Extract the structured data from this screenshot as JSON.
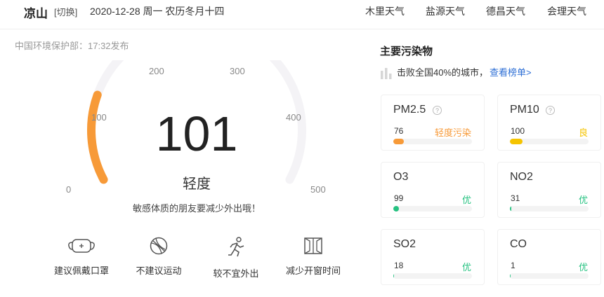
{
  "header": {
    "city": "凉山",
    "switch_label": "[切换]",
    "date_line": "2020-12-28  周一  农历冬月十四",
    "nearby": [
      "木里天气",
      "盐源天气",
      "德昌天气",
      "会理天气"
    ]
  },
  "publish": "中国环境保护部：17:32发布",
  "aqi": {
    "value": "101",
    "level": "轻度",
    "advice": "敏感体质的朋友要减少外出哦！",
    "scale": [
      "0",
      "100",
      "200",
      "300",
      "400",
      "500"
    ],
    "fraction": 0.202,
    "color": "#f79a38"
  },
  "advices": [
    {
      "label": "建议佩戴口罩",
      "icon": "mask-icon"
    },
    {
      "label": "不建议运动",
      "icon": "ball-icon"
    },
    {
      "label": "较不宜外出",
      "icon": "running-icon"
    },
    {
      "label": "减少开窗时间",
      "icon": "window-icon"
    }
  ],
  "pollutants": {
    "title": "主要污染物",
    "rank_text": "击败全国40%的城市，",
    "rank_link": "查看榜单>",
    "items": [
      {
        "name": "PM2.5",
        "help": "?",
        "value": "76",
        "level": "轻度污染",
        "percent": 13,
        "color": "#f79a38"
      },
      {
        "name": "PM10",
        "help": "?",
        "value": "100",
        "level": "良",
        "percent": 16,
        "color": "#f5c400"
      },
      {
        "name": "O3",
        "value": "99",
        "level": "优",
        "percent": 7,
        "color": "#26c281"
      },
      {
        "name": "NO2",
        "value": "31",
        "level": "优",
        "percent": 2,
        "color": "#26c281"
      },
      {
        "name": "SO2",
        "value": "18",
        "level": "优",
        "percent": 1,
        "color": "#26c281"
      },
      {
        "name": "CO",
        "value": "1",
        "level": "优",
        "percent": 1,
        "color": "#26c281"
      }
    ]
  }
}
